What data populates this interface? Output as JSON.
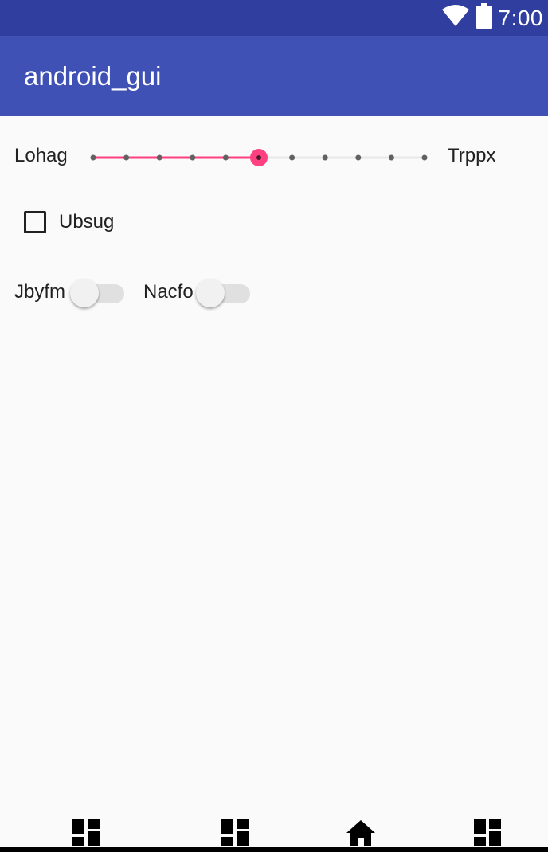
{
  "status_bar": {
    "time": "7:00",
    "icons": [
      "wifi-icon",
      "battery-icon"
    ],
    "color": "#303f9f"
  },
  "app_bar": {
    "title": "android_gui",
    "color": "#3f51b5"
  },
  "seekbar": {
    "start_label": "Lohag",
    "end_label": "Trppx",
    "max": 10,
    "progress": 5,
    "accent_color": "#ff4081"
  },
  "checkbox": {
    "label": "Ubsug",
    "checked": false
  },
  "switches": [
    {
      "label": "Jbyfm",
      "checked": false
    },
    {
      "label": "Nacfo",
      "checked": false
    }
  ],
  "bottom_nav": {
    "items": [
      {
        "icon": "dashboard-icon"
      },
      {
        "icon": "dashboard-icon"
      },
      {
        "icon": "home-icon"
      },
      {
        "icon": "dashboard-icon"
      }
    ]
  }
}
